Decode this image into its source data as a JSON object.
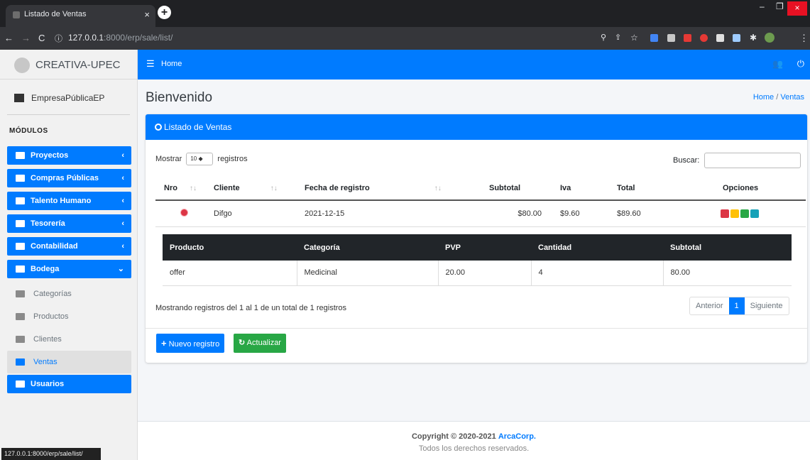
{
  "browser": {
    "tab_title": "Listado de Ventas",
    "tab_close": "×",
    "new_tab": "+",
    "url_host": "127.0.0.1",
    "url_rest": ":8000/erp/sale/list/",
    "status_url": "127.0.0.1:8000/erp/sale/list/"
  },
  "sidebar": {
    "brand": "CREATIVA-UPEC",
    "company": "EmpresaPúblicaEP",
    "section": "MÓDULOS",
    "items": [
      {
        "label": "Proyectos",
        "chev": "‹"
      },
      {
        "label": "Compras Públicas",
        "chev": "‹"
      },
      {
        "label": "Talento Humano",
        "chev": "‹"
      },
      {
        "label": "Tesorería",
        "chev": "‹"
      },
      {
        "label": "Contabilidad",
        "chev": "‹"
      },
      {
        "label": "Bodega",
        "chev": "⌄"
      }
    ],
    "sub_items": [
      {
        "label": "Categorías"
      },
      {
        "label": "Productos"
      },
      {
        "label": "Clientes"
      },
      {
        "label": "Ventas"
      }
    ],
    "users": "Usuarios"
  },
  "topbar": {
    "home": "Home"
  },
  "page": {
    "title": "Bienvenido",
    "breadcrumb_home": "Home",
    "breadcrumb_sep": "/",
    "breadcrumb_current": "Ventas"
  },
  "card": {
    "title": "Listado de Ventas",
    "show_prefix": "Mostrar",
    "show_value": "10 ◆",
    "show_suffix": "registros",
    "search_label": "Buscar:",
    "columns": [
      "Nro",
      "Cliente",
      "Fecha de registro",
      "Subtotal",
      "Iva",
      "Total",
      "Opciones"
    ],
    "row": {
      "cliente": "Difgo",
      "fecha": "2021-12-15",
      "subtotal": "$80.00",
      "iva": "$9.60",
      "total": "$89.60"
    },
    "detail_columns": [
      "Producto",
      "Categoría",
      "PVP",
      "Cantidad",
      "Subtotal"
    ],
    "detail_row": [
      "offer",
      "Medicinal",
      "20.00",
      "4",
      "80.00"
    ],
    "info": "Mostrando registros del 1 al 1 de un total de 1 registros",
    "pager": {
      "prev": "Anterior",
      "current": "1",
      "next": "Siguiente"
    },
    "btn_new": "Nuevo registro",
    "btn_refresh": "Actualizar"
  },
  "footer": {
    "copyright_prefix": "Copyright © 2020-2021",
    "company": "ArcaCorp.",
    "rights": "Todos los derechos reservados."
  },
  "colors": {
    "primary": "#007bff",
    "danger": "#dc3545",
    "warning": "#ffc107",
    "success": "#28a745",
    "info": "#17a2b8",
    "dark": "#212529"
  }
}
